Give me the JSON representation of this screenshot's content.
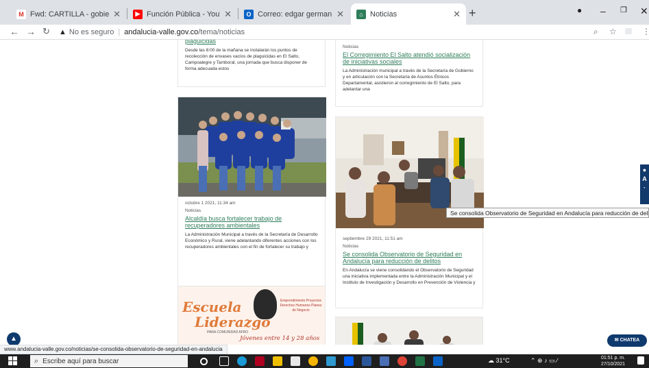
{
  "tabs": [
    {
      "title": "Fwd: CARTILLA - gobierno@andalu",
      "icon": "gmail-icon",
      "color": "#d93025",
      "glyph": "M"
    },
    {
      "title": "Función Pública - YouTube",
      "icon": "youtube-icon",
      "color": "#ff0000",
      "glyph": "▶"
    },
    {
      "title": "Correo: edgar german montaño",
      "icon": "outlook-icon",
      "color": "#0a64c8",
      "glyph": "O"
    },
    {
      "title": "Noticias",
      "icon": "site-icon",
      "color": "#2e7d5b",
      "glyph": "⌂",
      "active": true
    }
  ],
  "address": {
    "security_label": "No es seguro",
    "host": "andalucia-valle.gov.co",
    "path": "/tema/noticias"
  },
  "cards": {
    "c1": {
      "title": "plaguicidas",
      "excerpt": "Desde las 8:00 de la mañana se instalarán los puntos de recolección de envases vacíos de plaguicidas en El Salto, Campoalegre y Tamboral, una jornada que busca disponer de forma adecuada estos"
    },
    "c2": {
      "date": "octubre 1 2021, 11:34 am",
      "category": "Noticias",
      "title": "Alcaldía busca fortalecer trabajo de recuperadores ambientales",
      "excerpt": "La Administración Municipal a través de la Secretaría de Desarrollo Económico y Rural, viene adelantando diferentes acciones con los recuperadores ambientales con el fin de fortalecer su trabajo y"
    },
    "c3": {
      "poster_title_1": "Escuela",
      "poster_title_2": "Liderazgo",
      "poster_sub": "PARA COMUNIDAD AFRO",
      "poster_ages": "Jóvenes entre 14 y 28 años",
      "poster_side": "Emprendimiento Proyectos Derechos Humanos Planes de Negocio"
    },
    "c4": {
      "category": "Noticias",
      "title": "El Corregimiento El Salto atendió socialización de iniciativas sociales",
      "excerpt": "La Administración municipal a través de la Secretaría de Gobierno y en articulación con la Secretaría de Asuntos Étnicos Departamental, asistieron al corregimiento de El Salto, para adelantar una"
    },
    "c5": {
      "date": "septiembre 29 2021, 11:51 am",
      "category": "Noticias",
      "title": "Se consolida Observatorio de Seguridad en Andalucía para reducción de delitos",
      "excerpt": "En Andalucía se viene consolidando el Observatorio de Seguridad una iniciativa implementada entre la Administración Municipal y el Instituto de Investigación y Desarrollo en Prevención de Violencia y"
    }
  },
  "tooltip": "Se consolida Observatorio de Seguridad en Andalucía para  reducción de delitos",
  "chat_label": "CHATEA",
  "status_url": "www.andalucia-valle.gov.co/noticias/se-consolida-observatorio-de-seguridad-en-andalucia",
  "taskbar": {
    "search_placeholder": "Escribe aquí para buscar",
    "weather": "31°C",
    "time": "01:51 p. m.",
    "date": "27/10/2021"
  }
}
